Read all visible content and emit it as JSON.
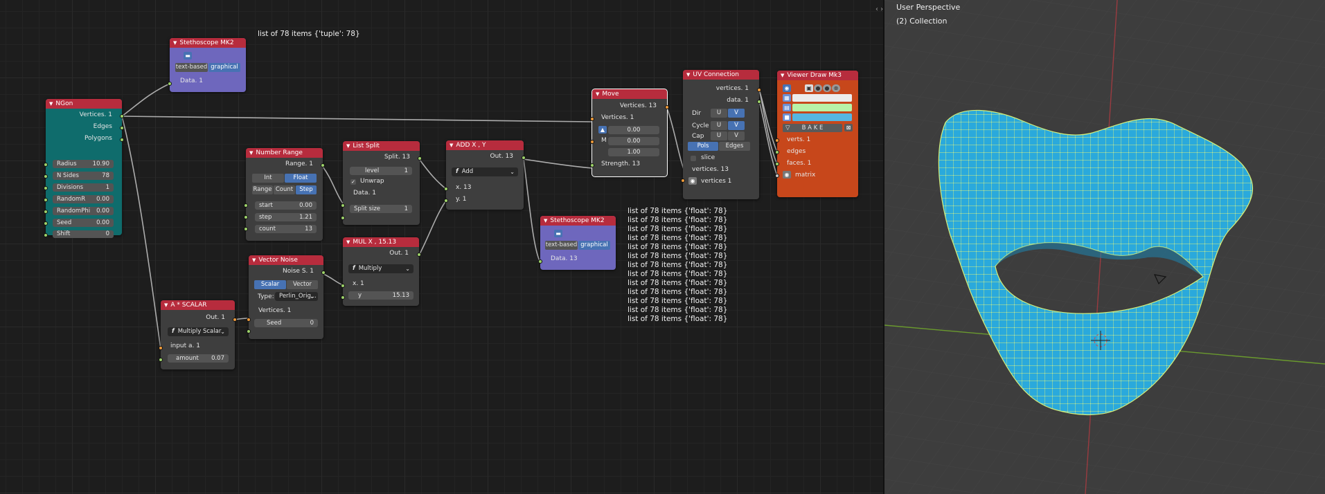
{
  "colors": {
    "node_header": "#b72c3d",
    "teal_node": "#0f6c6c",
    "purple_node": "#6e67bd",
    "orange_node": "#c7471b",
    "gray_node": "#3e3e3e",
    "selected_button": "#4772b3",
    "socket_green": "#9ed36a",
    "socket_orange": "#ee9a3a",
    "mesh_face": "#2aa9dc",
    "mesh_edge": "#d6f07a",
    "axis_x": "#9a3b40",
    "axis_y": "#6a9a2e"
  },
  "float_texts": {
    "tuple_list": "list of 78 items {'tuple': 78}"
  },
  "float_list": [
    "list of 78 items {'float': 78}",
    "list of 78 items {'float': 78}",
    "list of 78 items {'float': 78}",
    "list of 78 items {'float': 78}",
    "list of 78 items {'float': 78}",
    "list of 78 items {'float': 78}",
    "list of 78 items {'float': 78}",
    "list of 78 items {'float': 78}",
    "list of 78 items {'float': 78}",
    "list of 78 items {'float': 78}",
    "list of 78 items {'float': 78}",
    "list of 78 items {'float': 78}",
    "list of 78 items {'float': 78}"
  ],
  "ngon": {
    "title": "NGon",
    "outputs": [
      "Vertices. 1",
      "Edges",
      "Polygons"
    ],
    "fields": [
      {
        "label": "Radius",
        "value": "10.90"
      },
      {
        "label": "N Sides",
        "value": "78"
      },
      {
        "label": "Divisions",
        "value": "1"
      },
      {
        "label": "RandomR",
        "value": "0.00"
      },
      {
        "label": "RandomPhi",
        "value": "0.00"
      },
      {
        "label": "Seed",
        "value": "0.00"
      },
      {
        "label": "Shift",
        "value": "0"
      }
    ]
  },
  "steth1": {
    "title": "Stethoscope MK2",
    "mode_text": "text-based",
    "mode_graphical": "graphical",
    "input": "Data. 1"
  },
  "steth2": {
    "title": "Stethoscope MK2",
    "mode_text": "text-based",
    "mode_graphical": "graphical",
    "input": "Data. 13"
  },
  "numrange": {
    "title": "Number Range",
    "output": "Range. 1",
    "int": "Int",
    "float": "Float",
    "range": "Range",
    "count": "Count",
    "step": "Step",
    "fields": [
      {
        "label": "start",
        "value": "0.00"
      },
      {
        "label": "step",
        "value": "1.21"
      },
      {
        "label": "count",
        "value": "13"
      }
    ]
  },
  "listsplit": {
    "title": "List Split",
    "output": "Split. 13",
    "level_label": "level",
    "level_value": "1",
    "unwrap": "Unwrap",
    "input": "Data. 1",
    "split_label": "Split size",
    "split_value": "1"
  },
  "addxy": {
    "title": "ADD X , Y",
    "output": "Out. 13",
    "op": "Add",
    "in_x": "x. 13",
    "in_y": "y. 1"
  },
  "mul": {
    "title": "MUL X , 15.13",
    "output": "Out. 1",
    "op": "Multiply",
    "in_x": "x. 1",
    "y_label": "y",
    "y_value": "15.13"
  },
  "vnoise": {
    "title": "Vector Noise",
    "output": "Noise S. 1",
    "scalar": "Scalar",
    "vector": "Vector",
    "type_label": "Type:",
    "type_value": "Perlin_Orig...",
    "input": "Vertices. 1",
    "seed_label": "Seed",
    "seed_value": "0"
  },
  "ascalar": {
    "title": "A * SCALAR",
    "output": "Out. 1",
    "op": "Multiply Scalar",
    "input": "input a. 1",
    "amount_label": "amount",
    "amount_value": "0.07"
  },
  "move": {
    "title": "Move",
    "output": "Vertices. 13",
    "input": "Vertices. 1",
    "m_label": "M",
    "vals": [
      "0.00",
      "0.00",
      "1.00"
    ],
    "strength": "Strength. 13"
  },
  "uvconn": {
    "title": "UV Connection",
    "outputs": [
      "vertices. 1",
      "data. 1"
    ],
    "dir": "Dir",
    "cycle": "Cycle",
    "cap": "Cap",
    "u": "U",
    "v": "V",
    "pols": "Pols",
    "edges": "Edges",
    "slice": "slice",
    "in1": "vertices. 13",
    "in2": "vertices 1"
  },
  "viewer": {
    "title": "Viewer Draw Mk3",
    "bake": "B A K E",
    "inputs": [
      "verts. 1",
      "edges",
      "faces. 1",
      "matrix"
    ]
  },
  "viewport": {
    "title": "User Perspective",
    "collection": "(2) Collection"
  }
}
